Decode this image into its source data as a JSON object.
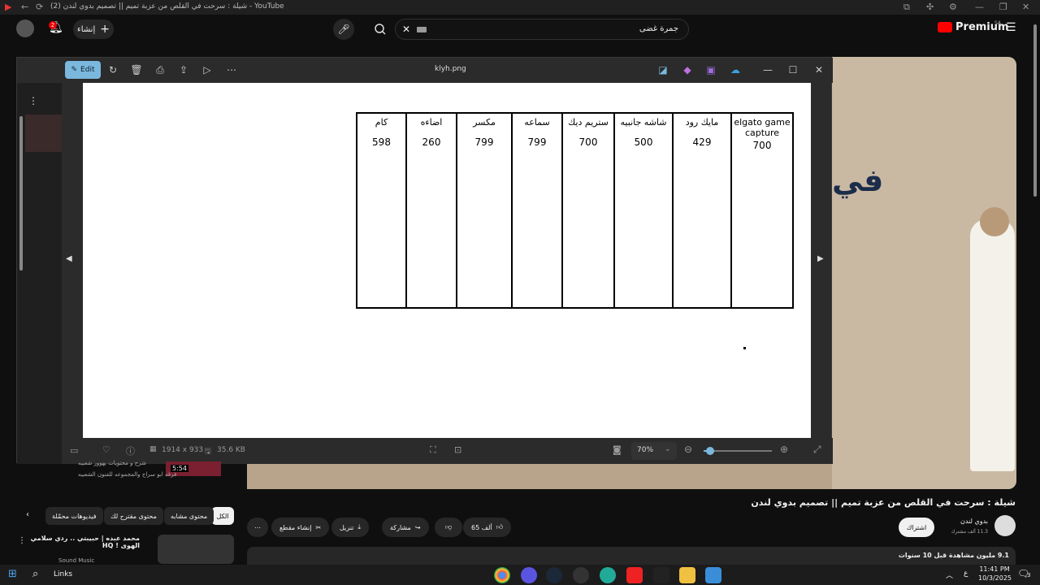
{
  "browser": {
    "tab_title": "(2) شيلة : سرحت في القلص من عزبة تميم || تصميم بدوي لندن - YouTube"
  },
  "header": {
    "premium_label": "Premium",
    "country_code": "SA",
    "search_value": "جمرة غضى",
    "create_label": "إنشاء",
    "notification_count": "2"
  },
  "viewer": {
    "file_name": "klyh.png",
    "edit_label": "Edit",
    "dimensions": "1914 x 933",
    "file_size": "35.6 KB",
    "zoom_level": "70%",
    "zoom_fraction": 0.1,
    "accent": "#7ab8dd"
  },
  "hand_table": {
    "columns": [
      {
        "title": "elgato game capture",
        "value": "700"
      },
      {
        "title": "مايك رود",
        "value": "429"
      },
      {
        "title": "شاشه جانبيه",
        "value": "500"
      },
      {
        "title": "ستريم ديك",
        "value": "700"
      },
      {
        "title": "سماعه",
        "value": "799"
      },
      {
        "title": "مكسر",
        "value": "799"
      },
      {
        "title": "اضاءه",
        "value": "260"
      },
      {
        "title": "كام",
        "value": "598"
      }
    ]
  },
  "video": {
    "title": "شيلة : سرحت في القلص من عزبة تميم || تصميم بدوي لندن",
    "channel": "بدوي لندن",
    "subscribers": "11.3 ألف مشترك",
    "subscribe_label": "اشتراك",
    "likes": "65 ألف",
    "share_label": "مشاركة",
    "download_label": "تنزيل",
    "clip_label": "إنشاء مقطع",
    "views": "9.1 مليون مشاهدة",
    "date": "قبل 10 سنوات",
    "overlay_text": "في"
  },
  "chips": [
    {
      "label": "الكل"
    },
    {
      "label": "محتوى مشابه"
    },
    {
      "label": "محتوى مقترح لك"
    },
    {
      "label": "فيديوهات محمّلة"
    }
  ],
  "sidebar": {
    "item1_title": "محمد عبده | حبيبتي .. ردي سلامي الهوى ! HQ",
    "item1_channel": "Sound Music",
    "item1_duration": "5:54",
    "item2_meta": "فرقه ابو سراج والمجموعه للفنون الشعبيه",
    "item2_text": "شرح و محتويات بهوور شعبيه"
  },
  "taskbar": {
    "search_label": "Links",
    "time": "11:41 PM",
    "date": "10/3/2025",
    "lang": "ع",
    "notif_count": "3"
  }
}
